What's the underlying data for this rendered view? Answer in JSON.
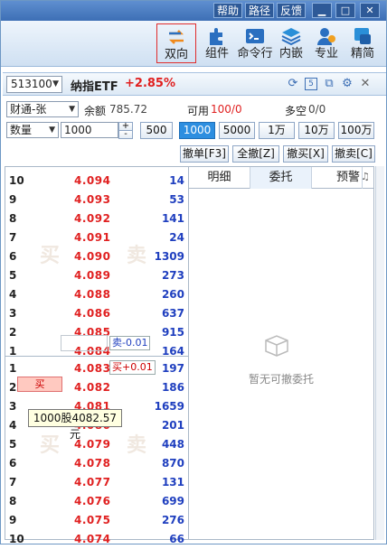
{
  "titlebar": {
    "help": "帮助",
    "path": "路径",
    "feedback": "反馈",
    "min": "▁",
    "max": "□",
    "close": "✕"
  },
  "toolbar": {
    "dual": "双向",
    "component": "组件",
    "cmdline": "命令行",
    "embed": "内嵌",
    "pro": "专业",
    "simple": "精简"
  },
  "header": {
    "code": "513100",
    "name": "纳指ETF",
    "change": "+2.85%"
  },
  "account": {
    "type": "财通-张",
    "balance_label": "余额",
    "balance": "785.72",
    "available_label": "可用",
    "available": "100/0",
    "longshort_label": "多空",
    "longshort": "0/0"
  },
  "qty": {
    "label": "数量",
    "value": "1000",
    "presets": [
      "500",
      "1000",
      "5000",
      "1万",
      "10万",
      "100万"
    ],
    "selected": "1000"
  },
  "actions": {
    "cancel": "撤单[F3]",
    "cancel_all": "全撤[Z]",
    "cancel_buy": "撤买[X]",
    "cancel_sell": "撤卖[C]"
  },
  "ask": [
    {
      "level": "10",
      "price": "4.094",
      "vol": "14"
    },
    {
      "level": "9",
      "price": "4.093",
      "vol": "53"
    },
    {
      "level": "8",
      "price": "4.092",
      "vol": "141"
    },
    {
      "level": "7",
      "price": "4.091",
      "vol": "24"
    },
    {
      "level": "6",
      "price": "4.090",
      "vol": "1309"
    },
    {
      "level": "5",
      "price": "4.089",
      "vol": "273"
    },
    {
      "level": "4",
      "price": "4.088",
      "vol": "260"
    },
    {
      "level": "3",
      "price": "4.086",
      "vol": "637"
    },
    {
      "level": "2",
      "price": "4.085",
      "vol": "915"
    },
    {
      "level": "1",
      "price": "4.084",
      "vol": "164"
    }
  ],
  "bid": [
    {
      "level": "1",
      "price": "4.083",
      "vol": "197"
    },
    {
      "level": "2",
      "price": "4.082",
      "vol": "186"
    },
    {
      "level": "3",
      "price": "4.081",
      "vol": "1659"
    },
    {
      "level": "4",
      "price": "4.080",
      "vol": "201"
    },
    {
      "level": "5",
      "price": "4.079",
      "vol": "448"
    },
    {
      "level": "6",
      "price": "4.078",
      "vol": "870"
    },
    {
      "level": "7",
      "price": "4.077",
      "vol": "131"
    },
    {
      "level": "8",
      "price": "4.076",
      "vol": "699"
    },
    {
      "level": "9",
      "price": "4.075",
      "vol": "276"
    },
    {
      "level": "10",
      "price": "4.074",
      "vol": "66"
    }
  ],
  "book": {
    "sell_badge": "卖-0.01",
    "buy_badge": "买+0.01",
    "buy_button": "买",
    "tooltip": "1000股4082.57元",
    "wm_buy": "买",
    "wm_sell": "卖"
  },
  "tabs": {
    "detail": "明细",
    "orders": "委托",
    "alert": "预警"
  },
  "orders": {
    "empty": "暂无可撤委托"
  }
}
